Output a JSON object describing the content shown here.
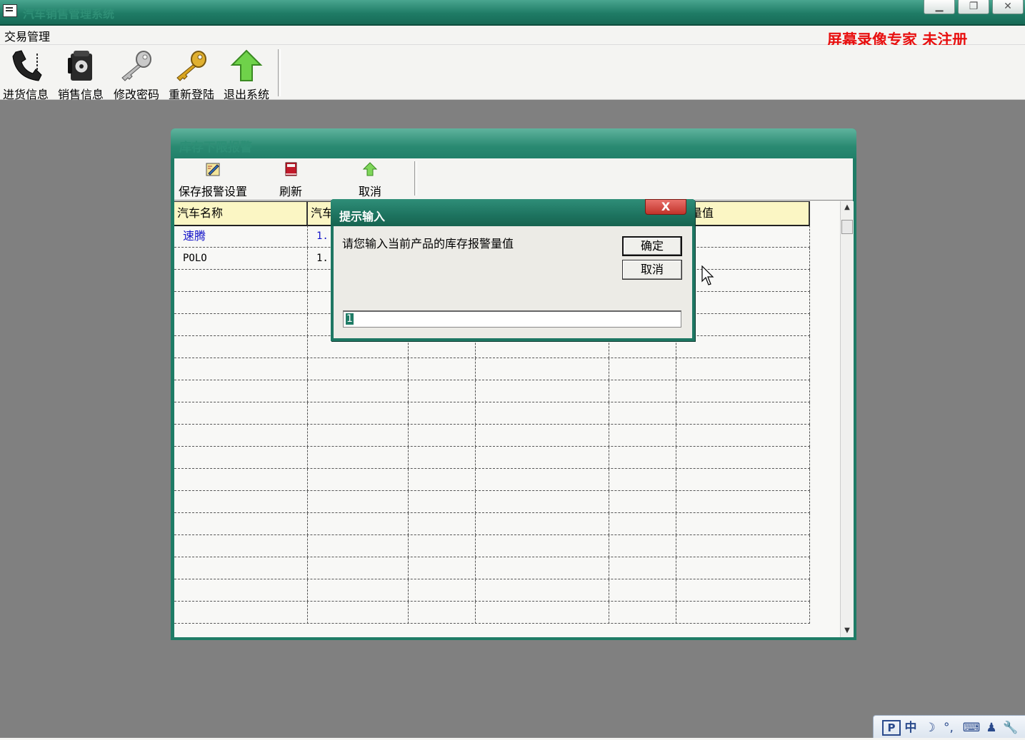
{
  "window": {
    "title": "汽车销售管理系统",
    "buttons": [
      "minimize",
      "restore",
      "close"
    ]
  },
  "menu": {
    "items": [
      "交易管理"
    ]
  },
  "watermark": "屏幕录像专家  未注册",
  "toolbar": {
    "items": [
      {
        "label": "进货信息",
        "icon": "telephone-icon"
      },
      {
        "label": "销售信息",
        "icon": "payphone-icon"
      },
      {
        "label": "修改密码",
        "icon": "silver-key-icon"
      },
      {
        "label": "重新登陆",
        "icon": "gold-key-icon"
      },
      {
        "label": "退出系统",
        "icon": "up-arrow-icon"
      }
    ]
  },
  "inner_window": {
    "title": "库存下限报警",
    "toolbar": {
      "save_label": "保存报警设置",
      "refresh_label": "刷新",
      "cancel_label": "取消"
    },
    "grid": {
      "headers": [
        "汽车名称",
        "汽车",
        "",
        "",
        "",
        "警量值"
      ],
      "rows": [
        {
          "name": "速腾",
          "code": "1."
        },
        {
          "name": "POLO",
          "code": "1."
        }
      ]
    }
  },
  "dialog": {
    "title": "提示输入",
    "close_label": "X",
    "prompt": "请您输入当前产品的库存报警量值",
    "ok_label": "确定",
    "cancel_label": "取消",
    "input_value": "1"
  },
  "ime_bar": {
    "items": [
      "P",
      "中",
      "moon-icon",
      "punctuation-icon",
      "keyboard-icon",
      "user-icon",
      "wrench-icon"
    ],
    "mode_label": "中"
  },
  "colors": {
    "title_green": "#1f7c66",
    "watermark_red": "#e81010",
    "header_yellow": "#fbf6c4",
    "desktop_gray": "#808080"
  }
}
